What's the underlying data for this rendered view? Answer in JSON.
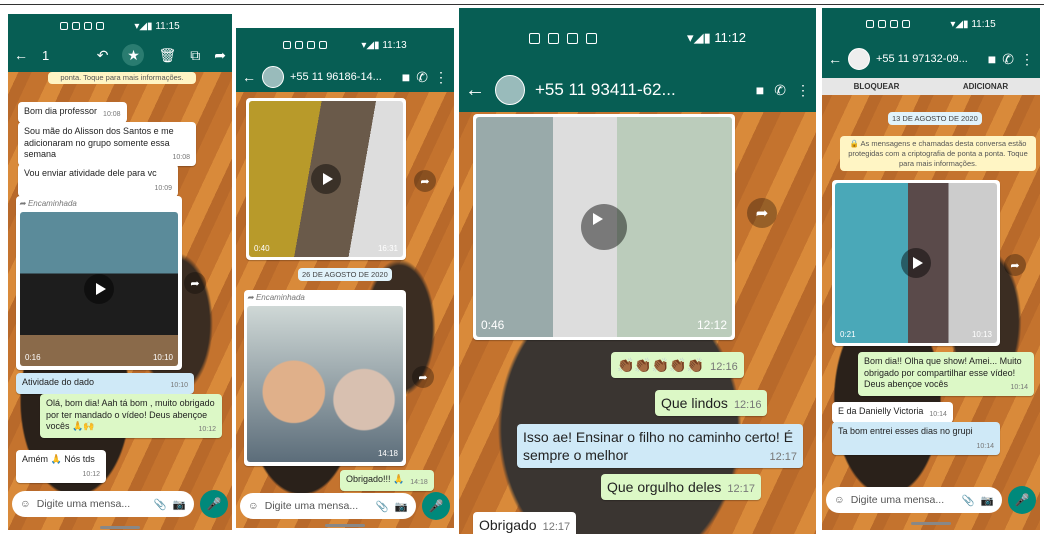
{
  "p1": {
    "time": "11:15",
    "sel_count": "1",
    "notice": "ponta. Toque para mais informações.",
    "msgs": [
      {
        "text": "Bom dia professor",
        "time": "10:08"
      },
      {
        "text": "Sou mãe do Alisson dos Santos e me adicionaram no grupo somente essa semana",
        "time": "10:08"
      },
      {
        "text": "Vou enviar atividade dele para vc",
        "time": "10:09"
      }
    ],
    "fwd_label": "Encaminhada",
    "video_dur": "0:16",
    "video_time": "10:10",
    "caption": "Atividade do dado",
    "caption_time": "10:10",
    "out1": "Olá, bom dia! Aah tá bom , muito obrigado por ter mandado o vídeo! Deus abençoe vocês 🙏🙌",
    "out1_time": "10:12",
    "in2": "Amém 🙏 Nós tds",
    "in2_time": "10:12",
    "placeholder": "Digite uma mensa..."
  },
  "p2": {
    "time": "11:13",
    "contact": "+55 11 96186-14...",
    "video_dur": "0:40",
    "video_time": "16:31",
    "date": "26 DE AGOSTO DE 2020",
    "fwd_label": "Encaminhada",
    "img_time": "14:18",
    "out": "Obrigado!!! 🙏",
    "out_time": "14:18",
    "placeholder": "Digite uma mensa..."
  },
  "p3": {
    "time": "11:12",
    "contact": "+55 11 93411-62...",
    "video_dur": "0:46",
    "video_time": "12:12",
    "msgs": [
      {
        "text": "👏🏾👏🏾👏🏾👏🏾👏🏾",
        "time": "12:16"
      },
      {
        "text": "Que lindos",
        "time": "12:16"
      },
      {
        "text": "Isso ae! Ensinar o filho no caminho certo! É sempre o melhor",
        "time": "12:17"
      },
      {
        "text": "Que orgulho deles",
        "time": "12:17"
      }
    ],
    "in": "Obrigado",
    "in_time": "12:17"
  },
  "p4": {
    "time": "11:15",
    "contact": "+55 11 97132-09...",
    "tab_block": "BLOQUEAR",
    "tab_add": "ADICIONAR",
    "date": "13 DE AGOSTO DE 2020",
    "notice": "🔒 As mensagens e chamadas desta conversa estão protegidas com a criptografia de ponta a ponta. Toque para mais informações.",
    "video_dur": "0:21",
    "video_time": "10:13",
    "out": "Bom dia!! Olha que show! Amei... Muito obrigado por compartilhar esse vídeo! Deus abençoe vocês",
    "out_time": "10:14",
    "in1": "E da Danielly  Victoria",
    "in1_time": "10:14",
    "in2": "Ta bom  entrei esses dias no grupi",
    "in2_time": "10:14",
    "placeholder": "Digite uma mensa..."
  },
  "colors": {
    "header": "#075e54",
    "out_bubble": "#dcf8c6",
    "mic": "#00897b"
  }
}
